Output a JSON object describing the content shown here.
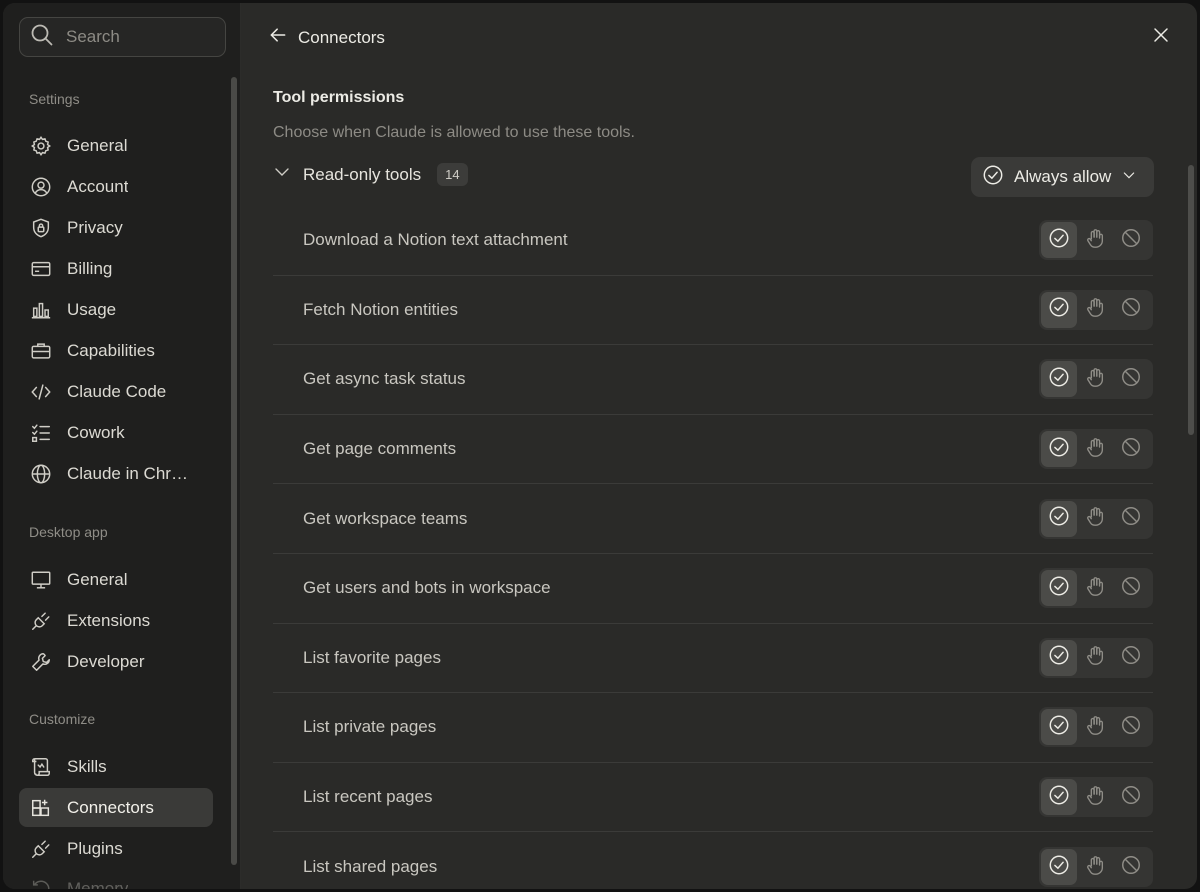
{
  "search": {
    "placeholder": "Search"
  },
  "sidebar": {
    "sections": [
      {
        "label": "Settings"
      },
      {
        "label": "Desktop app"
      },
      {
        "label": "Customize"
      }
    ],
    "items": [
      {
        "label": "General",
        "icon": "gear-icon"
      },
      {
        "label": "Account",
        "icon": "user-circle-icon"
      },
      {
        "label": "Privacy",
        "icon": "shield-lock-icon"
      },
      {
        "label": "Billing",
        "icon": "credit-card-icon"
      },
      {
        "label": "Usage",
        "icon": "bar-chart-icon"
      },
      {
        "label": "Capabilities",
        "icon": "briefcase-icon"
      },
      {
        "label": "Claude Code",
        "icon": "code-icon"
      },
      {
        "label": "Cowork",
        "icon": "checklist-icon"
      },
      {
        "label": "Claude in Chr…",
        "icon": "globe-icon"
      },
      {
        "label": "General",
        "icon": "monitor-icon"
      },
      {
        "label": "Extensions",
        "icon": "plug-icon"
      },
      {
        "label": "Developer",
        "icon": "wrench-icon"
      },
      {
        "label": "Skills",
        "icon": "scroll-icon"
      },
      {
        "label": "Connectors",
        "icon": "grid-plus-icon",
        "active": true
      },
      {
        "label": "Plugins",
        "icon": "plug-icon"
      },
      {
        "label": "Memory",
        "icon": "history-icon"
      }
    ]
  },
  "header": {
    "back_label": "Connectors"
  },
  "permissions": {
    "title": "Tool permissions",
    "subtitle": "Choose when Claude is allowed to use these tools.",
    "group": {
      "label": "Read-only tools",
      "count": "14"
    },
    "dropdown_label": "Always allow",
    "tools": [
      "Download a Notion text attachment",
      "Fetch Notion entities",
      "Get async task status",
      "Get page comments",
      "Get workspace teams",
      "Get users and bots in workspace",
      "List favorite pages",
      "List private pages",
      "List recent pages",
      "List shared pages"
    ]
  },
  "colors": {
    "background": "#2a2a28",
    "sidebar": "#1f1f1e",
    "active_item": "#3a3a38",
    "text": "#ecebe5",
    "muted_text": "#8d8b85"
  }
}
